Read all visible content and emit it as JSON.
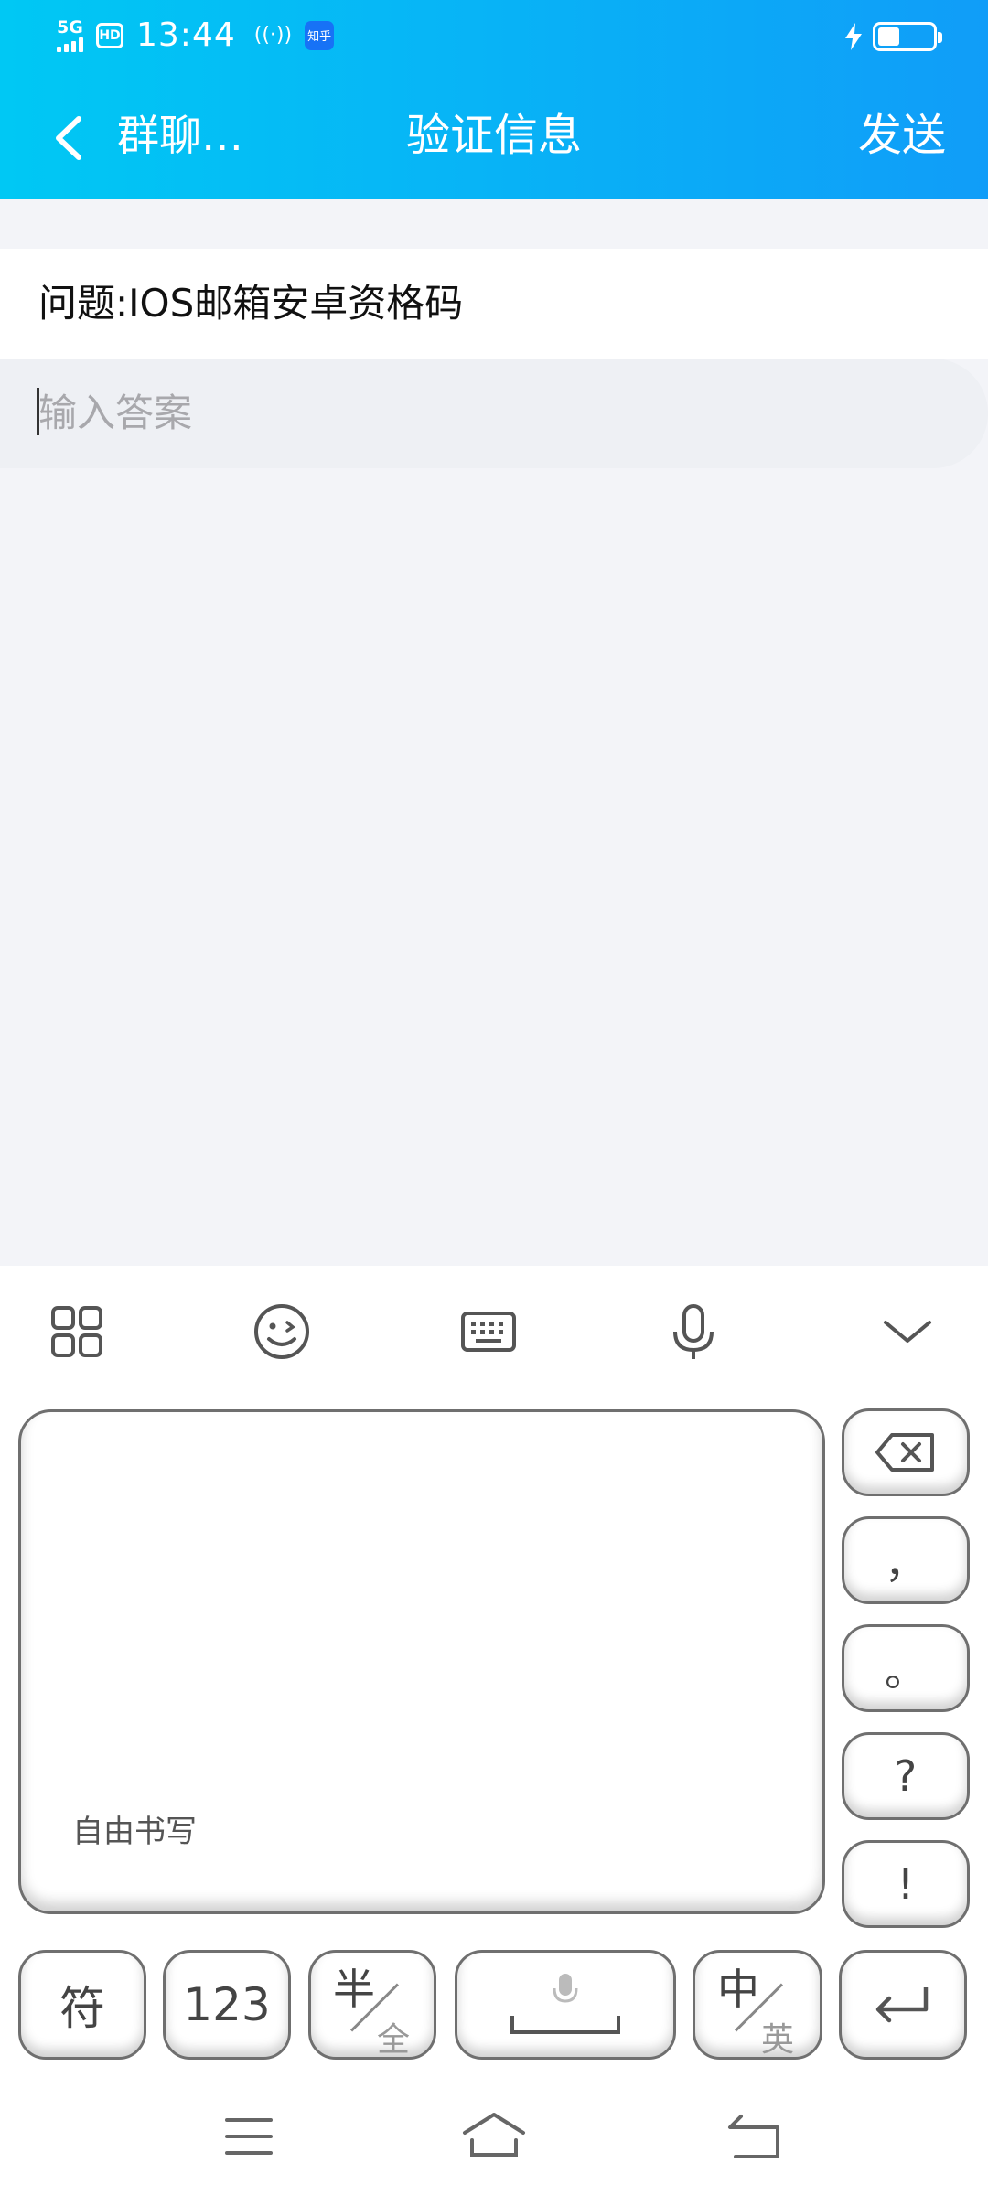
{
  "status_bar": {
    "network": "5G",
    "hd": "HD",
    "time": "13:44",
    "hotspot": "((·))",
    "app_badge": "知乎",
    "battery_level": 0.4
  },
  "header": {
    "back_label": "群聊…",
    "title": "验证信息",
    "send_label": "发送"
  },
  "form": {
    "question": "问题:IOS邮箱安卓资格码",
    "answer_placeholder": "输入答案",
    "answer_value": ""
  },
  "keyboard": {
    "toolbar": [
      "apps-grid-icon",
      "emoji-icon",
      "keyboard-icon",
      "microphone-icon",
      "collapse-icon"
    ],
    "handwriting_label": "自由书写",
    "side_keys": {
      "comma": "，",
      "period": "。",
      "question": "?",
      "exclaim": "!"
    },
    "bottom_keys": {
      "symbols": "符",
      "numbers": "123",
      "half_top": "半",
      "half_bottom": "全",
      "lang_top": "中",
      "lang_bottom": "英"
    }
  },
  "colors": {
    "header_start": "#00c8f4",
    "header_end": "#109df8",
    "background": "#f3f4f8"
  }
}
